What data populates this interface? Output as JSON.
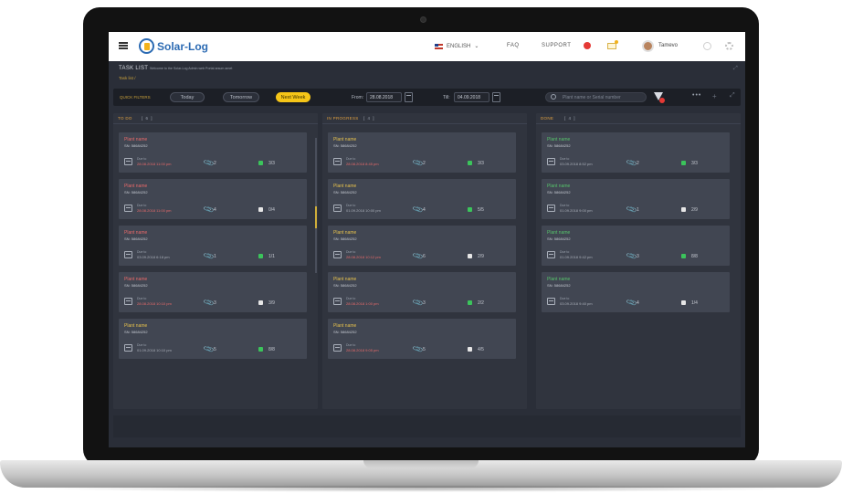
{
  "header": {
    "logo_text": "Solar-Log",
    "language": "ENGLISH",
    "faq": "FAQ",
    "support": "SUPPORT",
    "username": "Tamevo"
  },
  "page": {
    "title": "TASK LIST",
    "welcome": "Welcome to the Solar-Log Admin web Portal arsum amet",
    "breadcrumb": "Task list /"
  },
  "filters": {
    "label": "QUICK FILTERS",
    "today": "Today",
    "tomorrow": "Tomorrow",
    "next_week": "Next Week",
    "from_label": "From:",
    "from_value": "28.08.2018",
    "till_label": "Till:",
    "till_value": "04.09.2018",
    "search_placeholder": "Plant name or Serial number"
  },
  "columns": [
    {
      "title": "TO DO",
      "count": "[ 6 ]",
      "cards": [
        {
          "name": "Plant name",
          "sn": "SN: 58684252",
          "due_label": "Due to",
          "due": "28.08.2018 11:00 pm",
          "attachments": "2",
          "progress": "3/3",
          "status": "green",
          "name_color": "rd",
          "due_color": "red"
        },
        {
          "name": "Plant name",
          "sn": "SN: 58684252",
          "due_label": "Due to",
          "due": "28.08.2018 11:00 pm",
          "attachments": "4",
          "progress": "0/4",
          "status": "white",
          "name_color": "rd",
          "due_color": "red"
        },
        {
          "name": "Plant name",
          "sn": "SN: 58684252",
          "due_label": "Due to",
          "due": "03.09.2018 6:18 pm",
          "attachments": "1",
          "progress": "1/1",
          "status": "green",
          "name_color": "rd",
          "due_color": "gray"
        },
        {
          "name": "Plant name",
          "sn": "SN: 58684252",
          "due_label": "Due to",
          "due": "28.08.2018 10:10 pm",
          "attachments": "3",
          "progress": "3/9",
          "status": "white",
          "name_color": "rd",
          "due_color": "red"
        },
        {
          "name": "Plant name",
          "sn": "SN: 58684252",
          "due_label": "Due to",
          "due": "01.09.2018 10:10 pm",
          "attachments": "5",
          "progress": "8/8",
          "status": "green",
          "name_color": "yl",
          "due_color": "gray"
        }
      ]
    },
    {
      "title": "IN PROGRESS",
      "count": "[ 4 ]",
      "cards": [
        {
          "name": "Plant name",
          "sn": "SN: 58684252",
          "due_label": "Due to",
          "due": "28.08.2018 8:45 pm",
          "attachments": "2",
          "progress": "3/3",
          "status": "green",
          "name_color": "yl",
          "due_color": "red"
        },
        {
          "name": "Plant name",
          "sn": "SN: 58684252",
          "due_label": "Due to",
          "due": "01.09.2018 10:00 pm",
          "attachments": "4",
          "progress": "5/5",
          "status": "green",
          "name_color": "yl",
          "due_color": "gray"
        },
        {
          "name": "Plant name",
          "sn": "SN: 58684252",
          "due_label": "Due to",
          "due": "28.08.2018 10:12 pm",
          "attachments": "6",
          "progress": "2/9",
          "status": "white",
          "name_color": "yl",
          "due_color": "red"
        },
        {
          "name": "Plant name",
          "sn": "SN: 58684252",
          "due_label": "Due to",
          "due": "28.08.2018 1:00 pm",
          "attachments": "3",
          "progress": "2/2",
          "status": "green",
          "name_color": "yl",
          "due_color": "red"
        },
        {
          "name": "Plant name",
          "sn": "SN: 58684252",
          "due_label": "Due to",
          "due": "28.08.2018 9:05 pm",
          "attachments": "5",
          "progress": "4/5",
          "status": "white",
          "name_color": "yl",
          "due_color": "red"
        }
      ]
    },
    {
      "title": "DONE",
      "count": "[ 4 ]",
      "cards": [
        {
          "name": "Plant name",
          "sn": "SN: 58684252",
          "due_label": "Due to",
          "due": "03.09.2018 8:52 pm",
          "attachments": "2",
          "progress": "3/3",
          "status": "green",
          "name_color": "gn",
          "due_color": "gray"
        },
        {
          "name": "Plant name",
          "sn": "SN: 58684252",
          "due_label": "Due to",
          "due": "01.09.2018 9:00 pm",
          "attachments": "1",
          "progress": "2/9",
          "status": "white",
          "name_color": "gn",
          "due_color": "gray"
        },
        {
          "name": "Plant name",
          "sn": "SN: 58684252",
          "due_label": "Due to",
          "due": "01.09.2018 9:42 pm",
          "attachments": "3",
          "progress": "8/8",
          "status": "green",
          "name_color": "gn",
          "due_color": "gray"
        },
        {
          "name": "Plant name",
          "sn": "SN: 58684252",
          "due_label": "Due to",
          "due": "03.09.2018 9:40 pm",
          "attachments": "4",
          "progress": "1/4",
          "status": "white",
          "name_color": "gn",
          "due_color": "gray"
        }
      ]
    }
  ],
  "colors": {
    "accent": "#f5c518",
    "done_green": "#57c26b",
    "overdue_red": "#e86a6a",
    "in_progress_yellow": "#e6c14d"
  }
}
